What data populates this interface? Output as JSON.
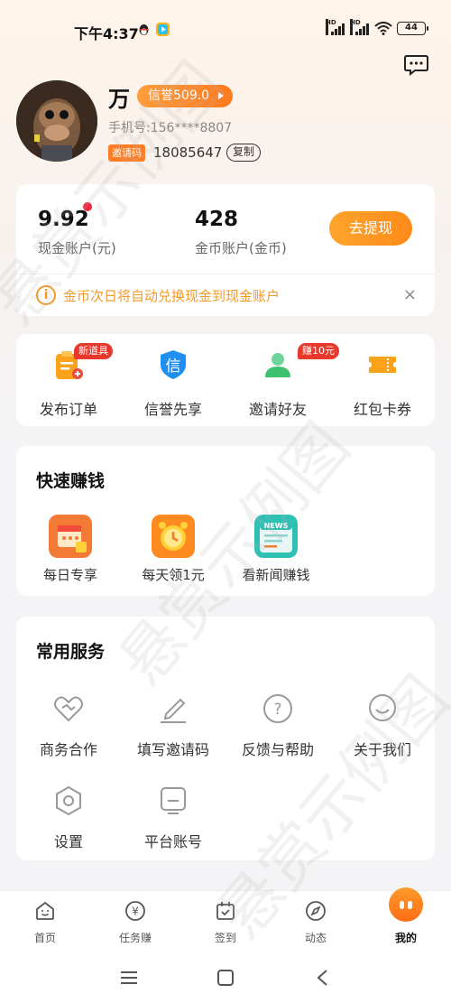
{
  "status_bar": {
    "time": "下午4:37",
    "signal1_label": "HD",
    "signal2_label": "HD",
    "battery": "44"
  },
  "profile": {
    "name": "万",
    "credit_label": "信誉509.0",
    "phone": "手机号:156****8807",
    "invite_tag": "邀请码",
    "invite_code": "18085647",
    "copy_label": "复制"
  },
  "account": {
    "cash_value": "9.92",
    "cash_label": "现金账户(元)",
    "coin_value": "428",
    "coin_label": "金币账户(金币)",
    "withdraw_label": "去提现",
    "notice": "金币次日将自动兑换现金到现金账户",
    "notice_icon": "i",
    "notice_close": "×"
  },
  "tools": [
    {
      "label": "发布订单",
      "badge": "新道具",
      "icon": "order-icon",
      "color": "#f9a21a"
    },
    {
      "label": "信誉先享",
      "badge": "",
      "icon": "credit-shield-icon",
      "color": "#1f8ff0"
    },
    {
      "label": "邀请好友",
      "badge": "赚10元",
      "icon": "invite-friend-icon",
      "color": "#3cc26e"
    },
    {
      "label": "红包卡券",
      "badge": "",
      "icon": "coupon-icon",
      "color": "#f9a21a"
    }
  ],
  "quick_earn": {
    "title": "快速赚钱",
    "items": [
      {
        "label": "每日专享",
        "icon": "calendar-gift-icon"
      },
      {
        "label": "每天领1元",
        "icon": "alarm-clock-icon"
      },
      {
        "label": "看新闻赚钱",
        "icon": "news-icon",
        "icon_text": "NEWS"
      }
    ]
  },
  "services": {
    "title": "常用服务",
    "items": [
      {
        "label": "商务合作",
        "icon": "handshake-heart-icon"
      },
      {
        "label": "填写邀请码",
        "icon": "pencil-icon"
      },
      {
        "label": "反馈与帮助",
        "icon": "help-icon",
        "icon_text": "?"
      },
      {
        "label": "关于我们",
        "icon": "chat-bubble-icon"
      },
      {
        "label": "设置",
        "icon": "settings-hex-icon"
      },
      {
        "label": "平台账号",
        "icon": "account-tablet-icon"
      }
    ]
  },
  "bottom_nav": [
    {
      "label": "首页",
      "icon": "home-smile-icon",
      "active": false
    },
    {
      "label": "任务赚",
      "icon": "yen-coin-icon",
      "icon_text": "¥",
      "active": false
    },
    {
      "label": "签到",
      "icon": "calendar-check-icon",
      "active": false
    },
    {
      "label": "动态",
      "icon": "compass-icon",
      "active": false
    },
    {
      "label": "我的",
      "icon": "mine-face-icon",
      "active": true
    }
  ],
  "colors": {
    "accent_orange": "#ff8a1a",
    "notice_orange": "#f39a2a",
    "badge_red": "#e8382c",
    "dot_red": "#f0283c"
  },
  "watermark": "悬赏示例图"
}
